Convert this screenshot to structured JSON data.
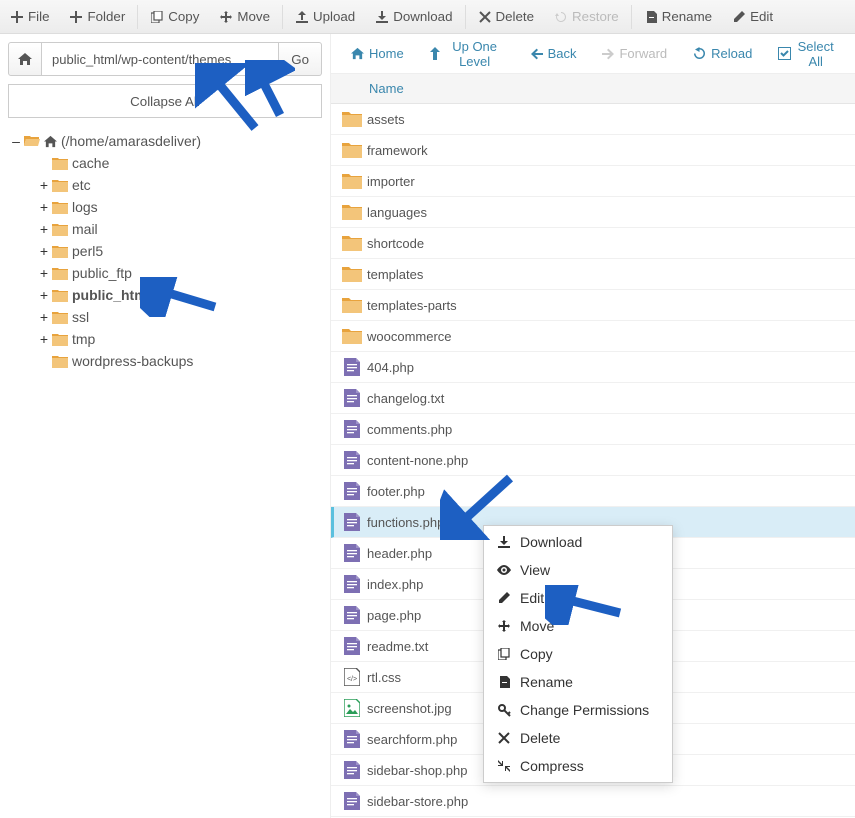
{
  "top_toolbar": {
    "file": "File",
    "folder": "Folder",
    "copy": "Copy",
    "move": "Move",
    "upload": "Upload",
    "download": "Download",
    "delete": "Delete",
    "restore": "Restore",
    "rename": "Rename",
    "edit": "Edit"
  },
  "pathbar": {
    "path_value": "public_html/wp-content/themes",
    "go": "Go"
  },
  "collapse_all": "Collapse All",
  "tree": {
    "root_label": "(/home/amarasdeliver)",
    "items": [
      {
        "label": "cache",
        "exp": "",
        "indent": 1
      },
      {
        "label": "etc",
        "exp": "+",
        "indent": 1
      },
      {
        "label": "logs",
        "exp": "+",
        "indent": 1
      },
      {
        "label": "mail",
        "exp": "+",
        "indent": 1
      },
      {
        "label": "perl5",
        "exp": "+",
        "indent": 1
      },
      {
        "label": "public_ftp",
        "exp": "+",
        "indent": 1
      },
      {
        "label": "public_html",
        "exp": "+",
        "indent": 1,
        "bold": true
      },
      {
        "label": "ssl",
        "exp": "+",
        "indent": 1
      },
      {
        "label": "tmp",
        "exp": "+",
        "indent": 1
      },
      {
        "label": "wordpress-backups",
        "exp": "",
        "indent": 1
      }
    ]
  },
  "nav_toolbar": {
    "home": "Home",
    "up": "Up One Level",
    "back": "Back",
    "forward": "Forward",
    "reload": "Reload",
    "select_all": "Select All"
  },
  "file_header": "Name",
  "files": [
    {
      "name": "assets",
      "kind": "folder"
    },
    {
      "name": "framework",
      "kind": "folder"
    },
    {
      "name": "importer",
      "kind": "folder"
    },
    {
      "name": "languages",
      "kind": "folder"
    },
    {
      "name": "shortcode",
      "kind": "folder"
    },
    {
      "name": "templates",
      "kind": "folder"
    },
    {
      "name": "templates-parts",
      "kind": "folder"
    },
    {
      "name": "woocommerce",
      "kind": "folder"
    },
    {
      "name": "404.php",
      "kind": "code"
    },
    {
      "name": "changelog.txt",
      "kind": "txt"
    },
    {
      "name": "comments.php",
      "kind": "code"
    },
    {
      "name": "content-none.php",
      "kind": "code"
    },
    {
      "name": "footer.php",
      "kind": "code"
    },
    {
      "name": "functions.php",
      "kind": "code",
      "selected": true
    },
    {
      "name": "header.php",
      "kind": "code"
    },
    {
      "name": "index.php",
      "kind": "code"
    },
    {
      "name": "page.php",
      "kind": "code"
    },
    {
      "name": "readme.txt",
      "kind": "txt"
    },
    {
      "name": "rtl.css",
      "kind": "css"
    },
    {
      "name": "screenshot.jpg",
      "kind": "img"
    },
    {
      "name": "searchform.php",
      "kind": "code"
    },
    {
      "name": "sidebar-shop.php",
      "kind": "code"
    },
    {
      "name": "sidebar-store.php",
      "kind": "code"
    }
  ],
  "context_menu": {
    "download": "Download",
    "view": "View",
    "edit": "Edit",
    "move": "Move",
    "copy": "Copy",
    "rename": "Rename",
    "change_permissions": "Change Permissions",
    "delete": "Delete",
    "compress": "Compress"
  }
}
